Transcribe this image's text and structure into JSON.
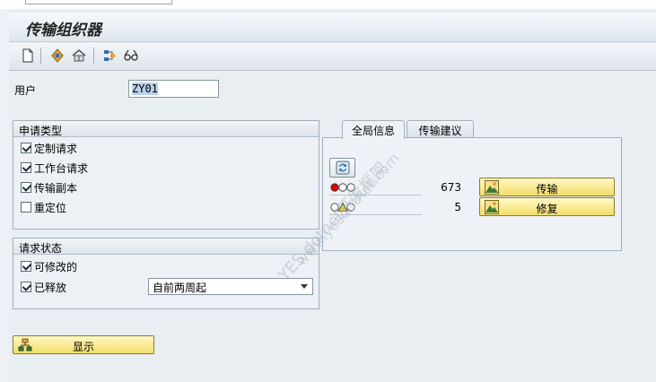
{
  "window": {
    "title": "传输组织器"
  },
  "toolbar": {
    "icons": [
      "new-document-icon",
      "navigate-icon",
      "hierarchy-icon",
      "configure-icon",
      "glasses-icon"
    ]
  },
  "user": {
    "label": "用户",
    "value": "ZY01"
  },
  "request_type": {
    "title": "申请类型",
    "options": [
      {
        "label": "定制请求",
        "checked": true
      },
      {
        "label": "工作台请求",
        "checked": true
      },
      {
        "label": "传输副本",
        "checked": true
      },
      {
        "label": "重定位",
        "checked": false
      }
    ]
  },
  "request_status": {
    "title": "请求状态",
    "options": [
      {
        "label": "可修改的",
        "checked": true
      },
      {
        "label": "已释放",
        "checked": true
      }
    ],
    "period": {
      "selected": "自前两周起"
    }
  },
  "tabs": [
    {
      "label": "全局信息",
      "active": true
    },
    {
      "label": "传输建议",
      "active": false
    }
  ],
  "global_info": {
    "rows": [
      {
        "status": "red",
        "count": "673",
        "action_label": "传输"
      },
      {
        "status": "yellow",
        "count": "5",
        "action_label": "修复"
      }
    ]
  },
  "display_button": {
    "label": "显示"
  },
  "watermark": {
    "line1": "YES dotnet开发框架",
    "line2": "www.yesdotnet.com"
  },
  "colors": {
    "button_yellow": "#f3dd69",
    "title_bg": "#dde6ee",
    "traffic_red": "#e00000",
    "traffic_yellow": "#f2d600"
  }
}
